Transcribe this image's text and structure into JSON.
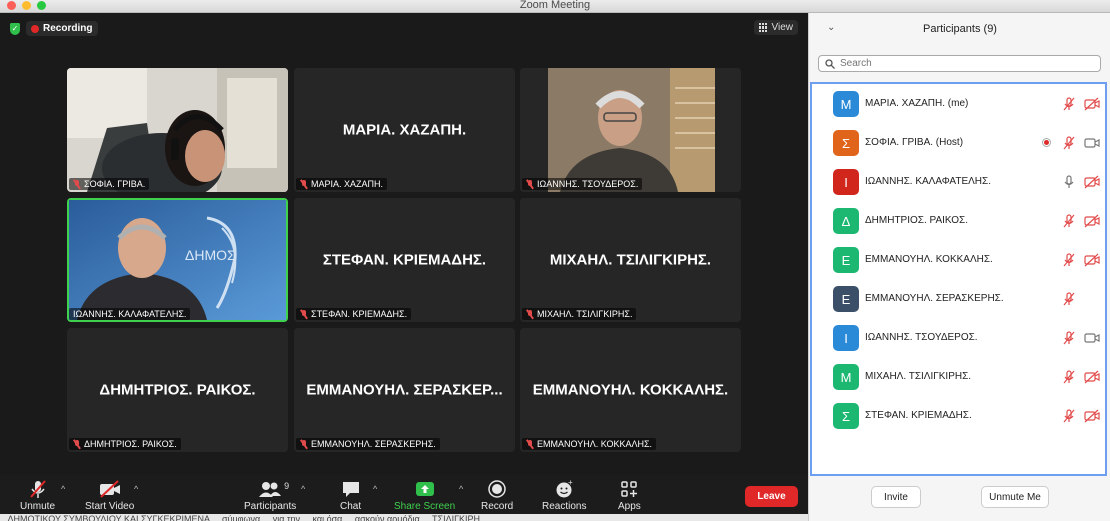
{
  "window": {
    "title": "Zoom Meeting"
  },
  "status": {
    "recording_label": "Recording",
    "view_label": "View"
  },
  "tiles": [
    {
      "display": "",
      "label": "ΣΟΦΙΑ. ΓΡΙΒΑ.",
      "video": true
    },
    {
      "display": "ΜΑΡΙΑ. ΧΑΖΑΠΗ.",
      "label": "ΜΑΡΙΑ. ΧΑΖΑΠΗ.",
      "video": false
    },
    {
      "display": "",
      "label": "ΙΩΑΝΝΗΣ. ΤΣΟΥΔΕΡΟΣ.",
      "video": true
    },
    {
      "display": "",
      "label": "ΙΩΑΝΝΗΣ. ΚΑΛΑΦΑΤΕΛΗΣ.",
      "video": true
    },
    {
      "display": "ΣΤΕΦΑΝ. ΚΡΙΕΜΑΔΗΣ.",
      "label": "ΣΤΕΦΑΝ. ΚΡΙΕΜΑΔΗΣ.",
      "video": false
    },
    {
      "display": "ΜΙΧΑΗΛ. ΤΣΙΛΙΓΚΙΡΗΣ.",
      "label": "ΜΙΧΑΗΛ. ΤΣΙΛΙΓΚΙΡΗΣ.",
      "video": false
    },
    {
      "display": "ΔΗΜΗΤΡΙΟΣ. ΡΑΙΚΟΣ.",
      "label": "ΔΗΜΗΤΡΙΟΣ. ΡΑΙΚΟΣ.",
      "video": false
    },
    {
      "display": "ΕΜΜΑΝΟΥΗΛ. ΣΕΡΑΣΚΕΡ...",
      "label": "ΕΜΜΑΝΟΥΗΛ. ΣΕΡΑΣΚΕΡΗΣ.",
      "video": false
    },
    {
      "display": "ΕΜΜΑΝΟΥΗΛ. ΚΟΚΚΑΛΗΣ.",
      "label": "ΕΜΜΑΝΟΥΗΛ. ΚΟΚΚΑΛΗΣ.",
      "video": false
    }
  ],
  "toolbar": {
    "unmute": "Unmute",
    "start_video": "Start Video",
    "participants": "Participants",
    "participants_count": "9",
    "chat": "Chat",
    "share_screen": "Share Screen",
    "record": "Record",
    "reactions": "Reactions",
    "apps": "Apps",
    "leave": "Leave"
  },
  "panel": {
    "title": "Participants (9)",
    "search_placeholder": "Search",
    "invite": "Invite",
    "unmute_me": "Unmute Me"
  },
  "participants": [
    {
      "initial": "Μ",
      "name": "ΜΑΡΙΑ. ΧΑΖΑΠΗ. (me)",
      "color": "#2a8ad8",
      "mic": "muted",
      "cam": "off",
      "rec": false
    },
    {
      "initial": "Σ",
      "name": "ΣΟΦΙΑ. ΓΡΙΒΑ. (Host)",
      "color": "#e0651a",
      "mic": "muted",
      "cam": "on",
      "rec": true
    },
    {
      "initial": "Ι",
      "name": "ΙΩΑΝΝΗΣ. ΚΑΛΑΦΑΤΕΛΗΣ.",
      "color": "#d0261c",
      "mic": "on",
      "cam": "off",
      "rec": false
    },
    {
      "initial": "Δ",
      "name": "ΔΗΜΗΤΡΙΟΣ. ΡΑΙΚΟΣ.",
      "color": "#1cb872",
      "mic": "muted",
      "cam": "off",
      "rec": false
    },
    {
      "initial": "Ε",
      "name": "ΕΜΜΑΝΟΥΗΛ. ΚΟΚΚΑΛΗΣ.",
      "color": "#1cb872",
      "mic": "muted",
      "cam": "off",
      "rec": false
    },
    {
      "initial": "Ε",
      "name": "ΕΜΜΑΝΟΥΗΛ. ΣΕΡΑΣΚΕΡΗΣ.",
      "color": "#3b5068",
      "mic": "muted",
      "cam": "none",
      "rec": false
    },
    {
      "initial": "Ι",
      "name": "ΙΩΑΝΝΗΣ. ΤΣΟΥΔΕΡΟΣ.",
      "color": "#2a8ad8",
      "mic": "muted",
      "cam": "on",
      "rec": false
    },
    {
      "initial": "Μ",
      "name": "ΜΙΧΑΗΛ. ΤΣΙΛΙΓΚΙΡΗΣ.",
      "color": "#1cb872",
      "mic": "muted",
      "cam": "off",
      "rec": false
    },
    {
      "initial": "Σ",
      "name": "ΣΤΕΦΑΝ. ΚΡΙΕΜΑΔΗΣ.",
      "color": "#1cb872",
      "mic": "muted",
      "cam": "off",
      "rec": false
    }
  ],
  "background_text": "...ΔΗΜΟΤΙΚΟΥ ΣΥΜΒΟΥΛΙΟΥ ΚΑΙ ΣΥΓΚΕΚΡΙΜΕΝΑ ... σύμφωνα ... για την ... και όσα ... ασκούν αρμόδια ... ΤΣΙΛΙΓΚΙΡΗ"
}
